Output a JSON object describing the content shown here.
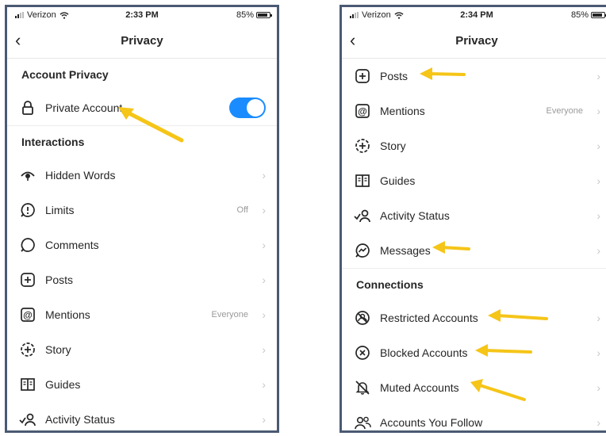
{
  "left": {
    "status": {
      "carrier": "Verizon",
      "time": "2:33 PM",
      "battery": "85%"
    },
    "nav": {
      "title": "Privacy"
    },
    "account_section": "Account Privacy",
    "private_account": {
      "label": "Private Account",
      "enabled": true
    },
    "interactions_section": "Interactions",
    "items": [
      {
        "label": "Hidden Words",
        "value": ""
      },
      {
        "label": "Limits",
        "value": "Off"
      },
      {
        "label": "Comments",
        "value": ""
      },
      {
        "label": "Posts",
        "value": ""
      },
      {
        "label": "Mentions",
        "value": "Everyone"
      },
      {
        "label": "Story",
        "value": ""
      },
      {
        "label": "Guides",
        "value": ""
      },
      {
        "label": "Activity Status",
        "value": ""
      }
    ]
  },
  "right": {
    "status": {
      "carrier": "Verizon",
      "time": "2:34 PM",
      "battery": "85%"
    },
    "nav": {
      "title": "Privacy"
    },
    "items": [
      {
        "label": "Posts",
        "value": ""
      },
      {
        "label": "Mentions",
        "value": "Everyone"
      },
      {
        "label": "Story",
        "value": ""
      },
      {
        "label": "Guides",
        "value": ""
      },
      {
        "label": "Activity Status",
        "value": ""
      },
      {
        "label": "Messages",
        "value": ""
      }
    ],
    "connections_section": "Connections",
    "connections": [
      {
        "label": "Restricted Accounts"
      },
      {
        "label": "Blocked Accounts"
      },
      {
        "label": "Muted Accounts"
      },
      {
        "label": "Accounts You Follow"
      }
    ]
  },
  "colors": {
    "toggle_on": "#1a8cff",
    "arrow": "#f5c518",
    "frame": "#4b5a73"
  },
  "icons": [
    "lock-icon",
    "hidden-words-icon",
    "limits-icon",
    "comments-icon",
    "posts-icon",
    "mentions-icon",
    "story-icon",
    "guides-icon",
    "activity-status-icon",
    "messages-icon",
    "restricted-icon",
    "blocked-icon",
    "muted-icon",
    "accounts-follow-icon",
    "chevron-right-icon",
    "back-chevron-icon"
  ]
}
